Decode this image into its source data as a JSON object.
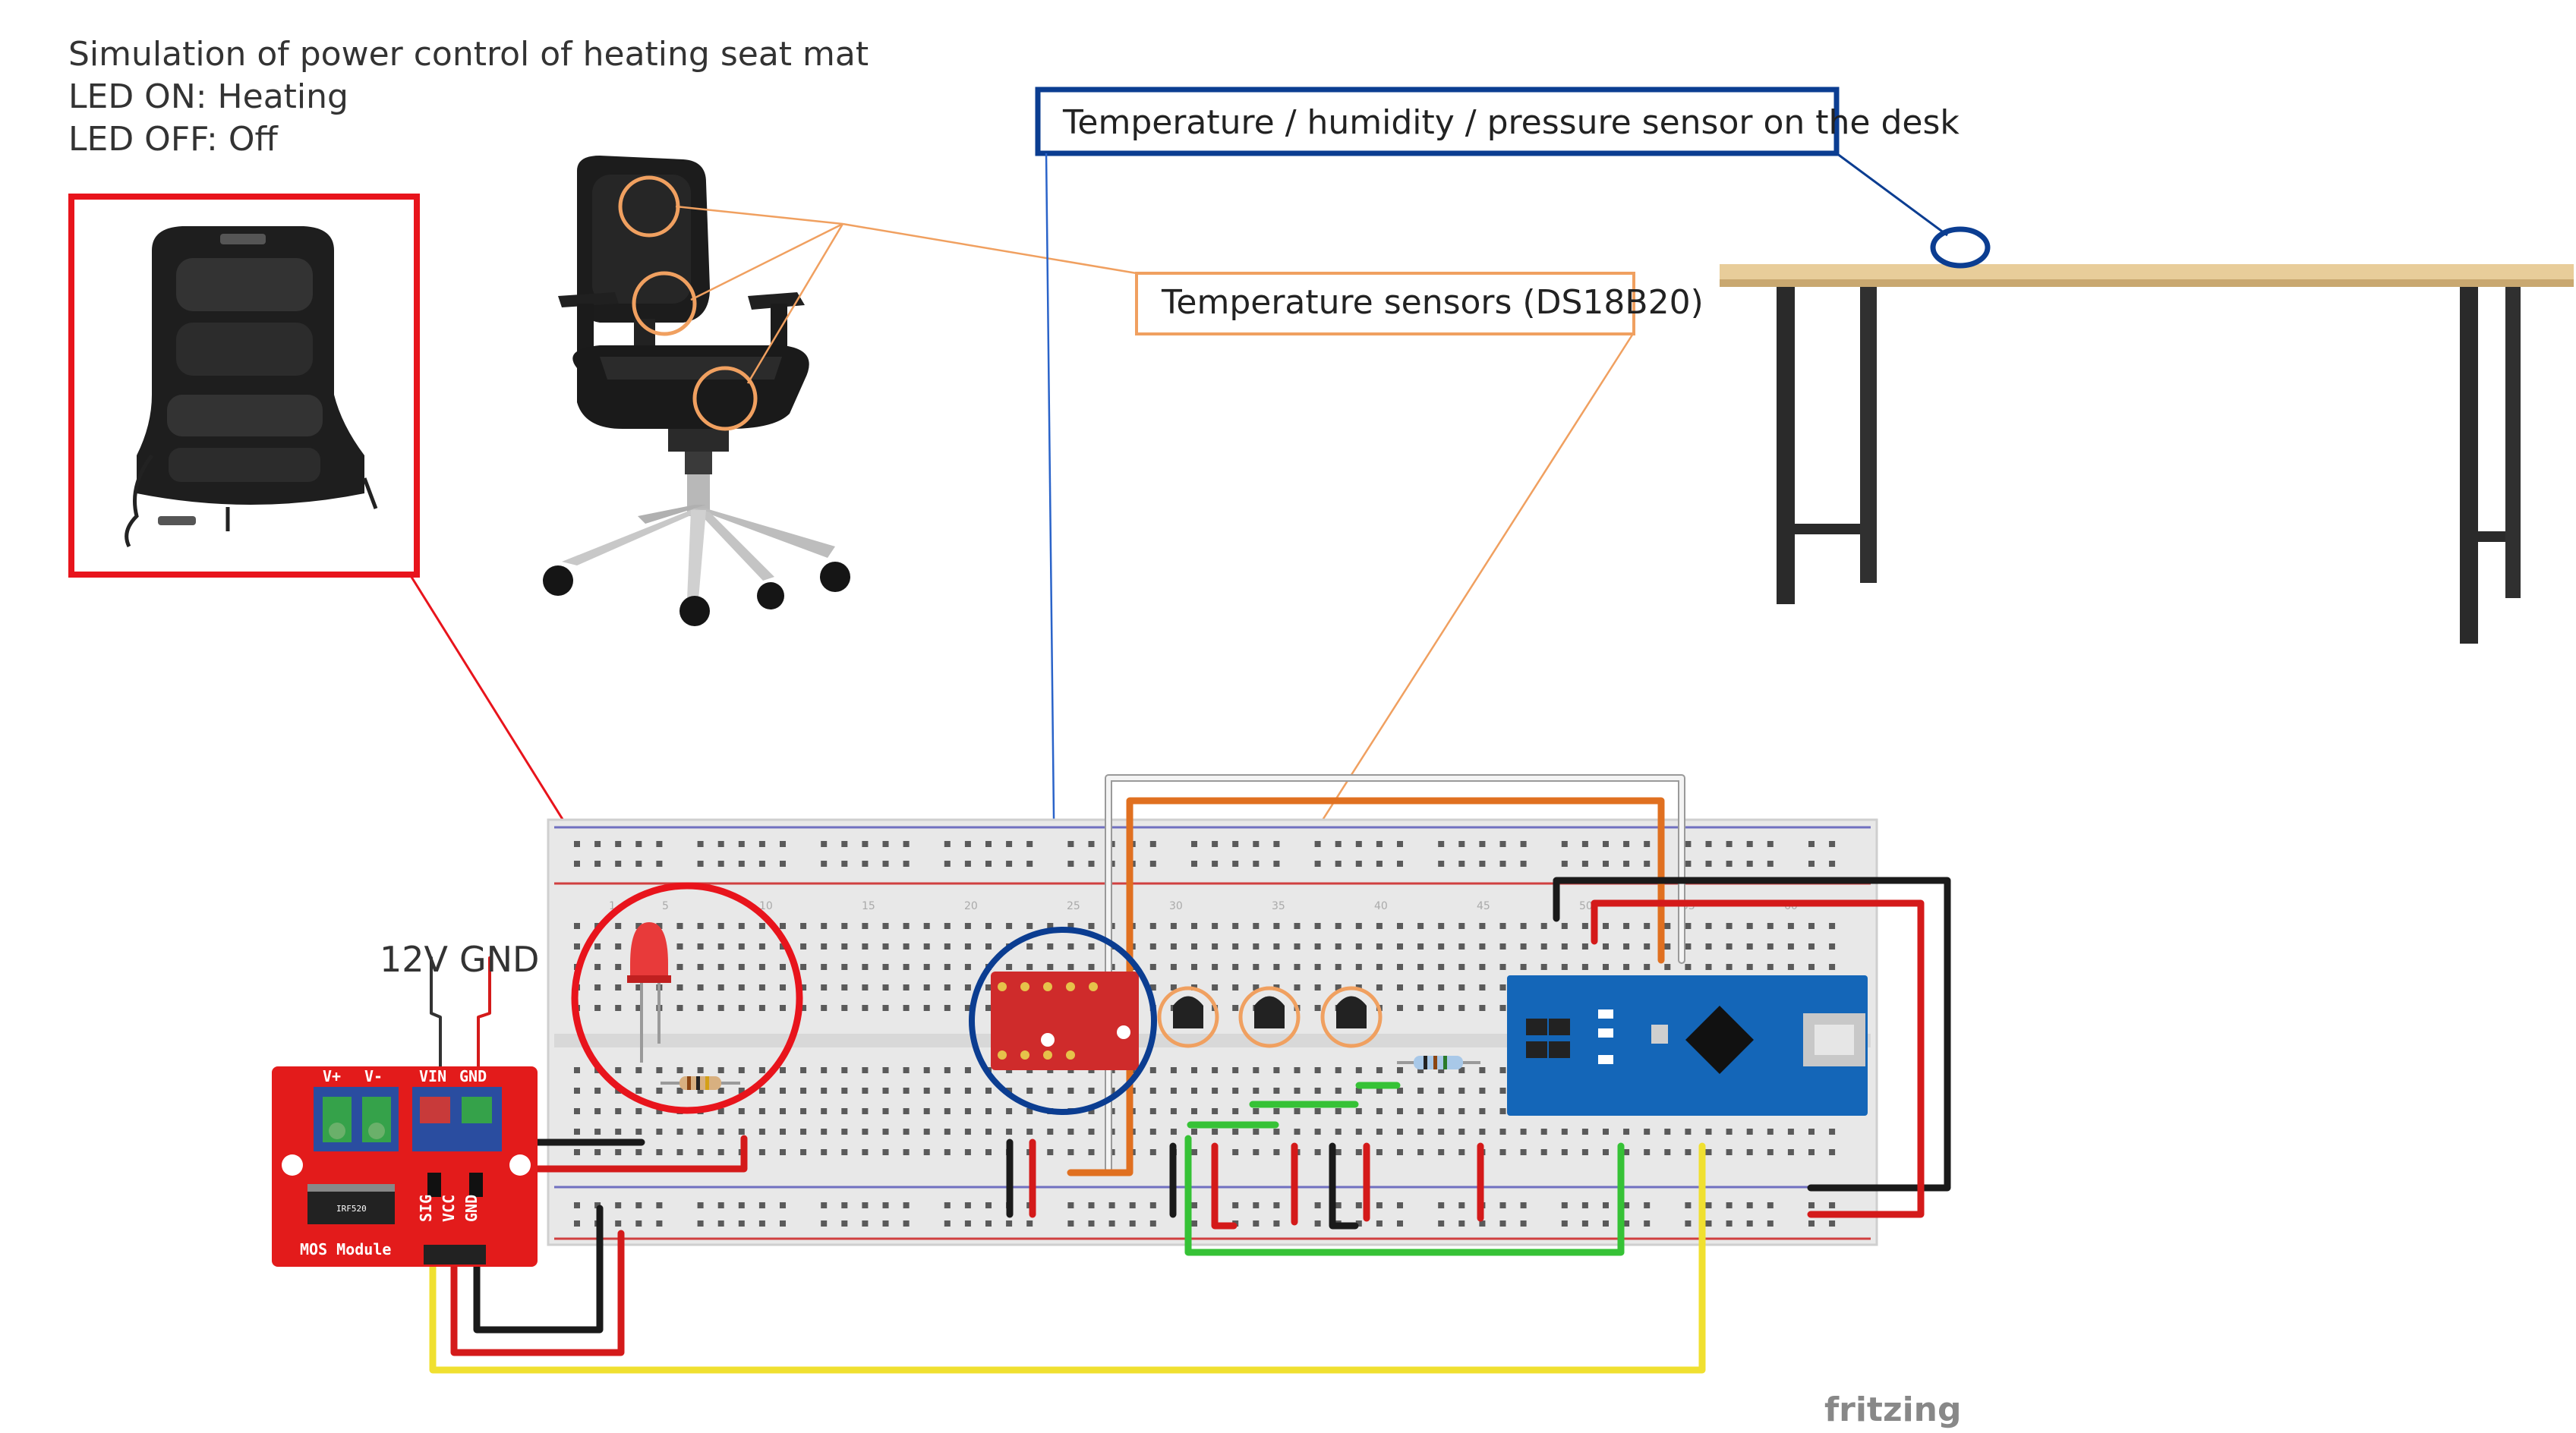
{
  "intro": {
    "line1": "Simulation of power control of heating seat mat",
    "line2": "LED ON: Heating",
    "line3": "LED OFF: Off"
  },
  "labels": {
    "env_sensor": "Temperature / humidity / pressure sensor on the desk",
    "temp_sensors": "Temperature sensors (DS18B20)",
    "v12": "12V",
    "gnd": "GND"
  },
  "mos_module": {
    "title": "MOS Module",
    "chip": "IRF520",
    "terminals": [
      "V+",
      "V-",
      "VIN",
      "GND"
    ],
    "pins": [
      "SIG",
      "VCC",
      "GND"
    ]
  },
  "breadboard_numbers": [
    "1",
    "5",
    "10",
    "15",
    "20",
    "25",
    "30",
    "35",
    "40",
    "45",
    "50",
    "55",
    "60"
  ],
  "branding": "fritzing",
  "colors": {
    "red_box": "#e8141c",
    "blue_box": "#0b3d91",
    "orange_box": "#f0a060",
    "wire_orange": "#e07020",
    "wire_green": "#36c236",
    "wire_yellow": "#f0e030",
    "wire_red": "#d41a1a",
    "wire_black": "#1a1a1a",
    "arduino": "#1466b8",
    "mos_board": "#e31b1b"
  }
}
